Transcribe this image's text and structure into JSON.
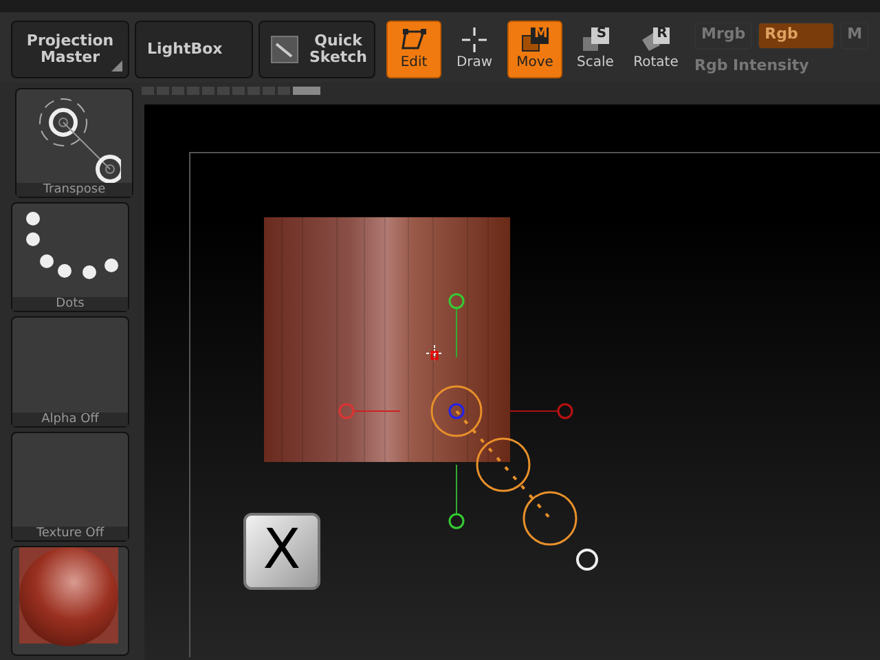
{
  "toolbar": {
    "buttons": [
      {
        "kind": "menu",
        "label": "Projection Master"
      },
      {
        "kind": "plain",
        "label": "LightBox"
      },
      {
        "kind": "sketch",
        "label": "Quick Sketch"
      }
    ],
    "modes": [
      {
        "kind": "edit",
        "label": "Edit",
        "selected": true
      },
      {
        "kind": "draw",
        "label": "Draw",
        "selected": false
      },
      {
        "kind": "move",
        "label": "Move",
        "badge": "M",
        "selected": true
      },
      {
        "kind": "scale",
        "label": "Scale",
        "badge": "S",
        "selected": false
      },
      {
        "kind": "rotate",
        "label": "Rotate",
        "badge": "R",
        "selected": false
      }
    ],
    "channels": [
      {
        "label": "Mrgb",
        "selected": false
      },
      {
        "label": "Rgb",
        "selected": true
      },
      {
        "label": "M",
        "selected": false
      }
    ],
    "intensity": {
      "label": "Rgb Intensity"
    }
  },
  "sidebar": {
    "tiles": [
      {
        "kind": "transpose",
        "label": "Transpose"
      },
      {
        "kind": "dots",
        "label": "Dots"
      },
      {
        "kind": "blank",
        "label": "Alpha Off"
      },
      {
        "kind": "blank",
        "label": "Texture Off"
      },
      {
        "kind": "material"
      }
    ]
  },
  "canvas": {
    "key_label": "X"
  }
}
